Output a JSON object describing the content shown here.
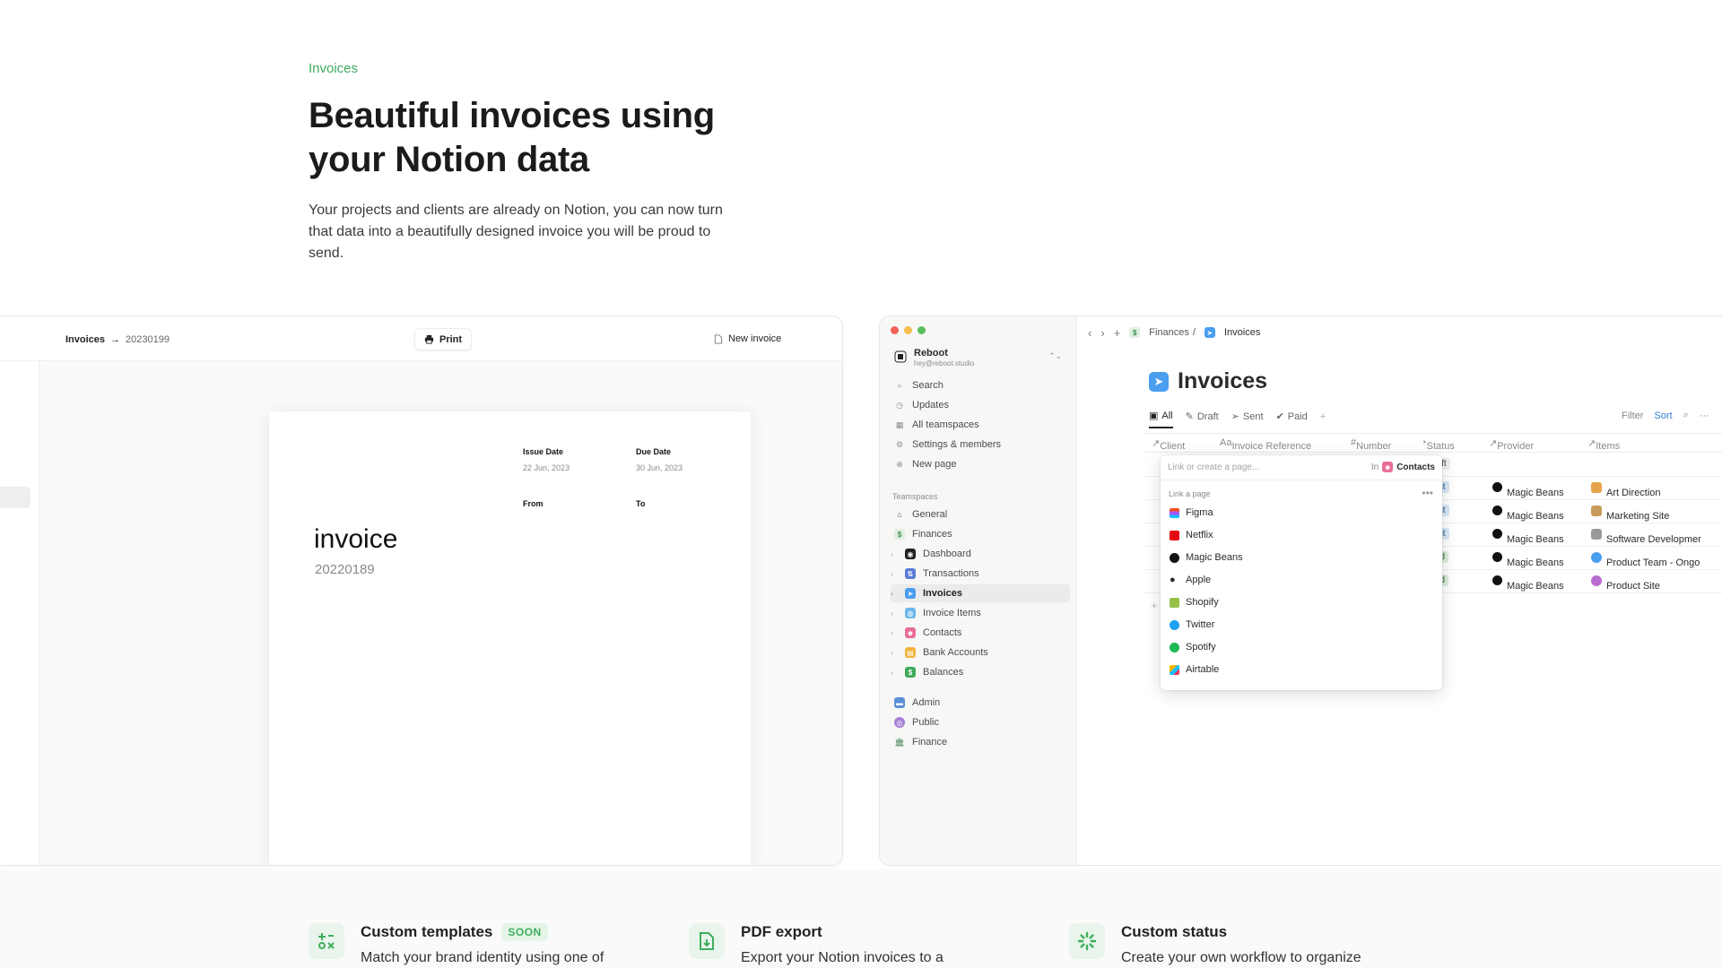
{
  "hero": {
    "eyebrow": "Invoices",
    "title_line1": "Beautiful invoices using",
    "title_line2": "your Notion data",
    "description": "Your projects and clients are already on Notion, you can now turn that data into a beautifully designed invoice you will be proud to send."
  },
  "invoice_app": {
    "breadcrumb_root": "Invoices",
    "breadcrumb_current": "20230199",
    "print_label": "Print",
    "new_invoice_label": "New invoice",
    "issue_date_label": "Issue Date",
    "issue_date_value": "22 Jun, 2023",
    "due_date_label": "Due Date",
    "due_date_value": "30 Jun, 2023",
    "from_label": "From",
    "to_label": "To",
    "invoice_title": "invoice",
    "invoice_number": "20220189"
  },
  "notion": {
    "workspace_name": "Reboot",
    "workspace_email": "hey@reboot.studio",
    "menu": [
      "Search",
      "Updates",
      "All teamspaces",
      "Settings & members",
      "New page"
    ],
    "teamspaces_label": "Teamspaces",
    "teamspaces": [
      "General",
      "Finances",
      "Dashboard",
      "Transactions",
      "Invoices",
      "Invoice Items",
      "Contacts",
      "Bank Accounts",
      "Balances"
    ],
    "other_spaces": [
      "Admin",
      "Public",
      "Finance"
    ],
    "breadcrumb_parent": "Finances",
    "breadcrumb_current": "Invoices",
    "page_title": "Invoices",
    "views": [
      "All",
      "Draft",
      "Sent",
      "Paid"
    ],
    "filter_label": "Filter",
    "sort_label": "Sort",
    "columns": [
      "Client",
      "Invoice Reference",
      "Number",
      "Status",
      "Provider",
      "Items"
    ],
    "rows": [
      {
        "status": "Draft",
        "provider": "",
        "item": ""
      },
      {
        "status": "Sent",
        "provider": "Magic Beans",
        "item": "Art Direction"
      },
      {
        "status": "Sent",
        "provider": "Magic Beans",
        "item": "Marketing Site"
      },
      {
        "status": "Sent",
        "provider": "Magic Beans",
        "item": "Software Developmer"
      },
      {
        "status": "Paid",
        "provider": "Magic Beans",
        "item": "Product Team - Ongo"
      },
      {
        "status": "Paid",
        "provider": "Magic Beans",
        "item": "Product Site"
      }
    ],
    "popup": {
      "placeholder": "Link or create a page...",
      "in_label": "In",
      "in_db": "Contacts",
      "header": "Link a page",
      "items": [
        "Figma",
        "Netflix",
        "Magic Beans",
        "Apple",
        "Shopify",
        "Twitter",
        "Spotify",
        "Airtable"
      ]
    }
  },
  "features": [
    {
      "title": "Custom templates",
      "badge": "SOON",
      "desc": "Match your brand identity using one of"
    },
    {
      "title": "PDF export",
      "badge": "",
      "desc": "Export your Notion invoices to a"
    },
    {
      "title": "Custom status",
      "badge": "",
      "desc": "Create your own workflow to organize"
    }
  ],
  "colors": {
    "accent_green": "#3fae5c",
    "notion_blue": "#4a9ef0",
    "sort_blue": "#2f7fd3"
  }
}
